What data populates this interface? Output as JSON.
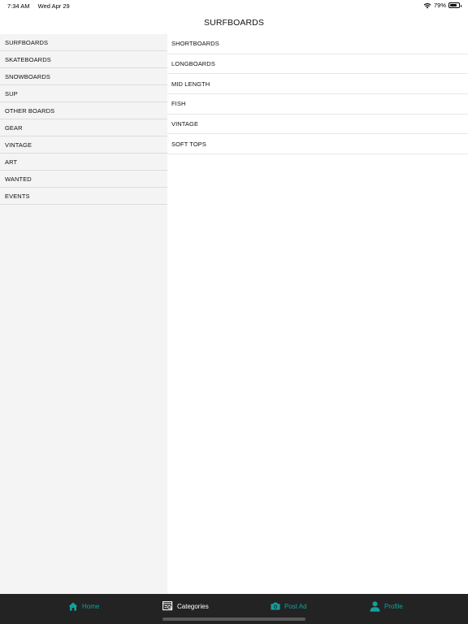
{
  "status_bar": {
    "time": "7:34 AM",
    "date": "Wed Apr 29",
    "battery_percent": "79%",
    "battery_level": 0.79
  },
  "header": {
    "title": "SURFBOARDS"
  },
  "sidebar": {
    "items": [
      {
        "label": "SURFBOARDS"
      },
      {
        "label": "SKATEBOARDS"
      },
      {
        "label": "SNOWBOARDS"
      },
      {
        "label": "SUP"
      },
      {
        "label": "OTHER BOARDS"
      },
      {
        "label": "GEAR"
      },
      {
        "label": "VINTAGE"
      },
      {
        "label": "ART"
      },
      {
        "label": "WANTED"
      },
      {
        "label": "EVENTS"
      }
    ]
  },
  "subcategories": {
    "items": [
      {
        "label": "SHORTBOARDS"
      },
      {
        "label": "LONGBOARDS"
      },
      {
        "label": "MID LENGTH"
      },
      {
        "label": "FISH"
      },
      {
        "label": "VINTAGE"
      },
      {
        "label": "SOFT TOPS"
      }
    ]
  },
  "tab_bar": {
    "tabs": [
      {
        "label": "Home",
        "icon": "home-icon"
      },
      {
        "label": "Categories",
        "icon": "categories-icon"
      },
      {
        "label": "Post Ad",
        "icon": "camera-icon"
      },
      {
        "label": "Profile",
        "icon": "person-icon"
      }
    ],
    "active_color": "#ffffff",
    "accent_color": "#12a19a",
    "background": "#232323"
  }
}
